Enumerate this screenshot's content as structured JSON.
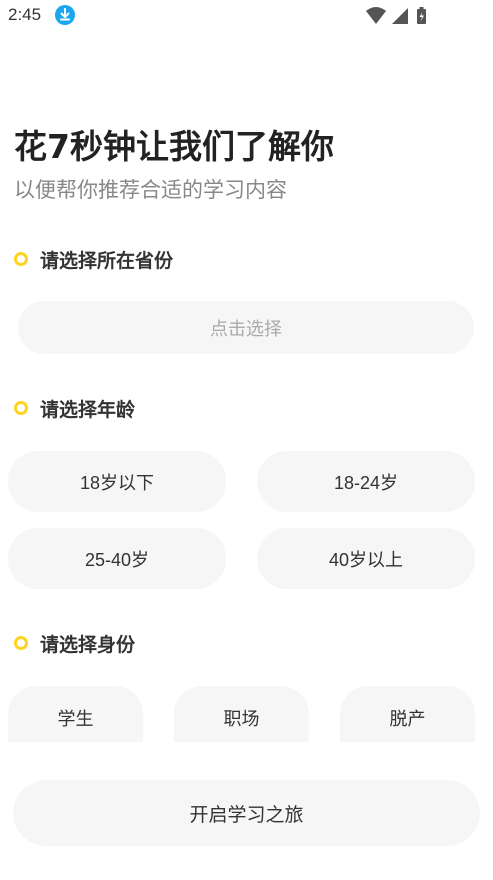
{
  "status_bar": {
    "time": "2:45"
  },
  "header": {
    "title": "花7秒钟让我们了解你",
    "subtitle": "以便帮你推荐合适的学习内容"
  },
  "province": {
    "label": "请选择所在省份",
    "placeholder": "点击选择"
  },
  "age": {
    "label": "请选择年龄",
    "options": [
      "18岁以下",
      "18-24岁",
      "25-40岁",
      "40岁以上"
    ]
  },
  "identity": {
    "label": "请选择身份",
    "options": [
      "学生",
      "职场",
      "脱产"
    ]
  },
  "actions": {
    "start_label": "开启学习之旅"
  },
  "colors": {
    "accent": "#ffd21f",
    "option_bg": "#f6f6f6",
    "download_badge": "#1aa7f0"
  }
}
